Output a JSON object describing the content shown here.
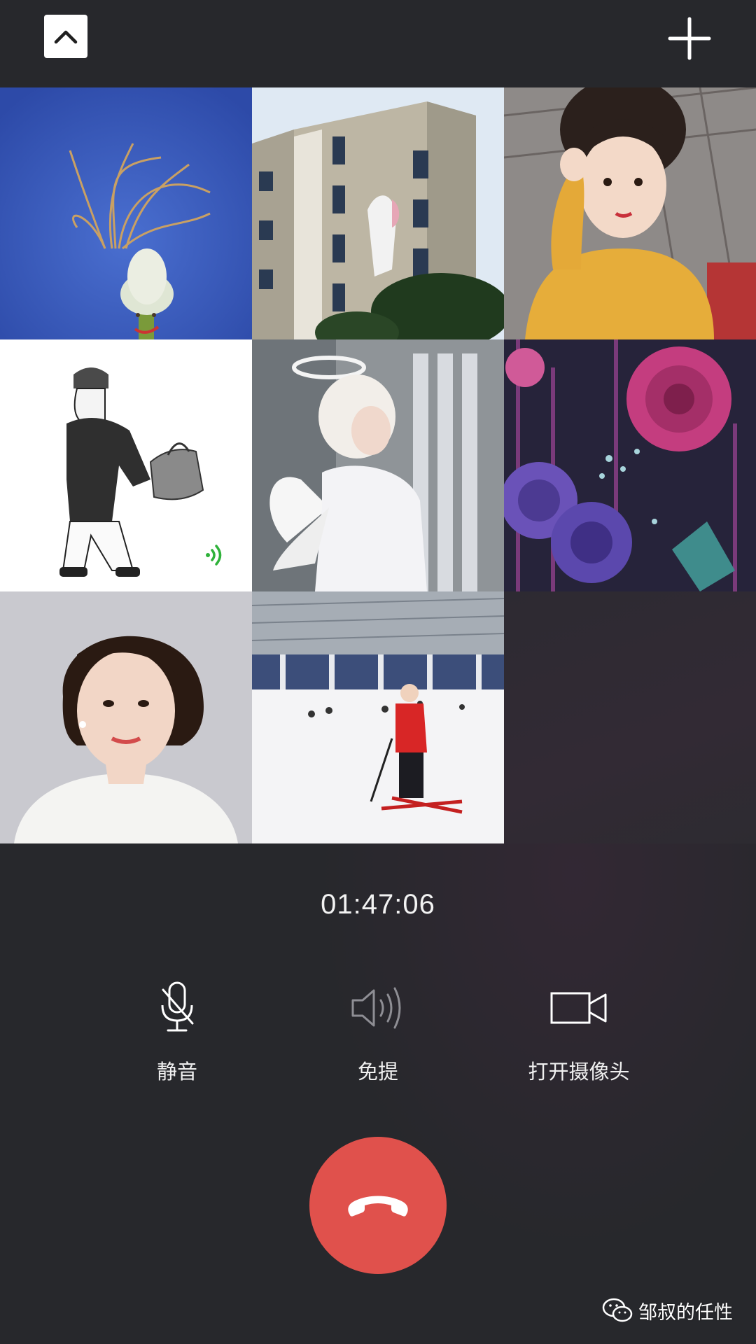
{
  "call": {
    "duration": "01:47:06"
  },
  "participants": [
    {
      "avatar": "green-onion-character",
      "speaking": false
    },
    {
      "avatar": "building-photo",
      "speaking": false
    },
    {
      "avatar": "girl-yellow-sweater-photo",
      "speaking": false
    },
    {
      "avatar": "sketch-man-illustration",
      "speaking": true
    },
    {
      "avatar": "angel-costume-photo",
      "speaking": false
    },
    {
      "avatar": "purple-roses-art",
      "speaking": false
    },
    {
      "avatar": "woman-portrait-photo",
      "speaking": false
    },
    {
      "avatar": "skier-photo",
      "speaking": false
    }
  ],
  "controls": {
    "mute_label": "静音",
    "speaker_label": "免提",
    "camera_label": "打开摄像头"
  },
  "watermark": {
    "text": "邹叔的任性"
  },
  "colors": {
    "background": "#27282c",
    "hangup": "#e0514c",
    "speaking_indicator": "#2fb23a"
  }
}
